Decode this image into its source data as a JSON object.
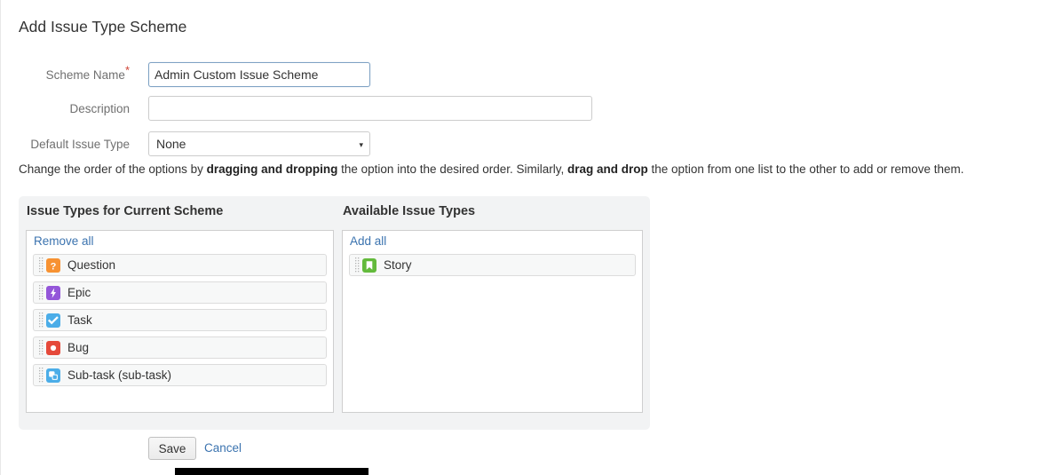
{
  "page": {
    "title": "Add Issue Type Scheme",
    "helper_text": {
      "part1": "Change the order of the options by ",
      "bold1": "dragging and dropping",
      "part2": " the option into the desired order. Similarly, ",
      "bold2": "drag and drop",
      "part3": " the option from one list to the other to add or remove them."
    }
  },
  "form": {
    "scheme_name": {
      "label": "Scheme Name",
      "required_marker": "*",
      "value": "Admin Custom Issue Scheme",
      "placeholder": ""
    },
    "description": {
      "label": "Description",
      "value": "",
      "placeholder": ""
    },
    "default_issue_type": {
      "label": "Default Issue Type",
      "selected": "None",
      "caret": "▾",
      "options": [
        "None"
      ]
    }
  },
  "dual_list": {
    "current_panel": {
      "heading": "Issue Types for Current Scheme",
      "action_label": "Remove all",
      "items": [
        {
          "label": "Question",
          "icon": "question-icon",
          "color": "#f79232"
        },
        {
          "label": "Epic",
          "icon": "epic-icon",
          "color": "#9456d9"
        },
        {
          "label": "Task",
          "icon": "task-icon",
          "color": "#4bade8"
        },
        {
          "label": "Bug",
          "icon": "bug-icon",
          "color": "#e5493a"
        },
        {
          "label": "Sub-task (sub-task)",
          "icon": "subtask-icon",
          "color": "#4bade8"
        }
      ]
    },
    "available_panel": {
      "heading": "Available Issue Types",
      "action_label": "Add all",
      "items": [
        {
          "label": "Story",
          "icon": "story-icon",
          "color": "#63ba3c"
        }
      ]
    }
  },
  "footer": {
    "save_label": "Save",
    "cancel_label": "Cancel"
  },
  "colors": {
    "link": "#3b73af",
    "required": "#d04437",
    "panel_bg": "#f2f3f4",
    "focus_border": "#7fa2c4"
  }
}
